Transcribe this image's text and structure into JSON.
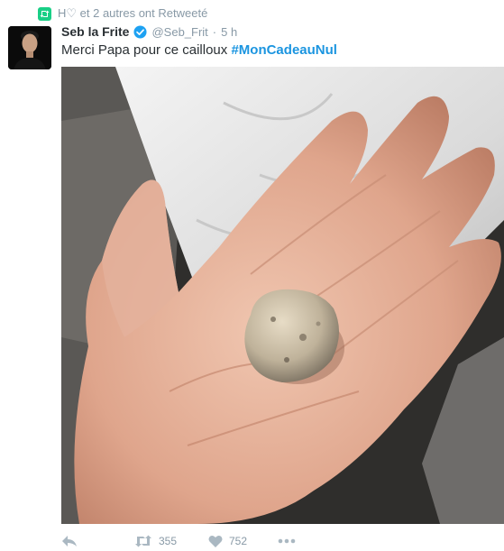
{
  "context": {
    "text": "H♡ et 2 autres ont Retweeté"
  },
  "tweet": {
    "author_name": "Seb la Frite",
    "handle": "@Seb_Frit",
    "separator": "·",
    "time": "5 h",
    "text": "Merci Papa pour ce cailloux ",
    "hashtag": "#MonCadeauNul",
    "verified": true
  },
  "actions": {
    "retweet_count": "355",
    "like_count": "752"
  },
  "colors": {
    "link": "#1b95e0",
    "retweet_green": "#19cf86",
    "muted": "#8899a6",
    "icon": "#aab8c2"
  },
  "icons": [
    "retweet-icon",
    "verified-icon",
    "reply-icon",
    "like-icon",
    "more-icon"
  ]
}
